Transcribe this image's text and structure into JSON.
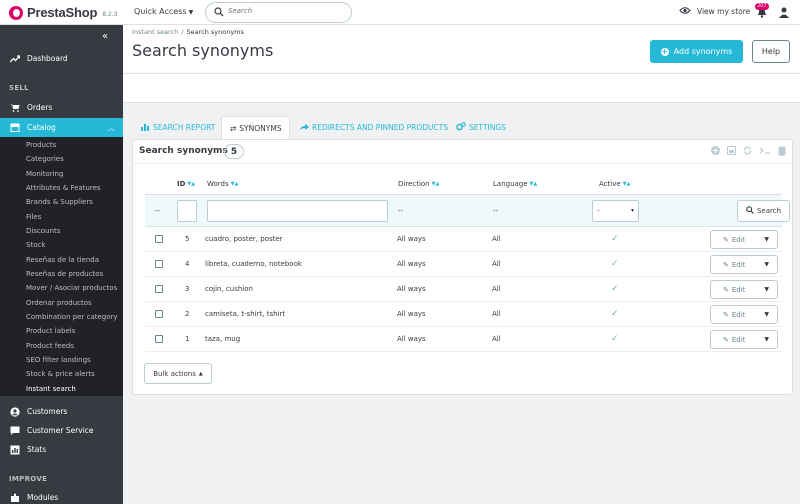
{
  "topbar": {
    "brand": "PrestaShop",
    "version": "8.2.3",
    "quick_access": "Quick Access",
    "search_placeholder": "Search",
    "view_store": "View my store",
    "notification_count": "207"
  },
  "sidebar": {
    "dashboard": "Dashboard",
    "section_sell": "SELL",
    "orders": "Orders",
    "catalog": "Catalog",
    "catalog_sub": [
      "Products",
      "Categories",
      "Monitoring",
      "Attributes & Features",
      "Brands & Suppliers",
      "Files",
      "Discounts",
      "Stock",
      "Reseñas de la tienda",
      "Reseñas de productos",
      "Mover / Asociar productos",
      "Ordenar productos",
      "Combination per category",
      "Product labels",
      "Product feeds",
      "SEO filter landings",
      "Stock & price alerts",
      "Instant search"
    ],
    "customers": "Customers",
    "customer_service": "Customer Service",
    "stats": "Stats",
    "section_improve": "IMPROVE",
    "modules": "Modules"
  },
  "header": {
    "breadcrumb_parent": "Instant search",
    "breadcrumb_current": "Search synonyms",
    "title": "Search synonyms",
    "add_button": "Add synonyms",
    "help_button": "Help"
  },
  "tabs": [
    {
      "label": "SEARCH REPORT",
      "icon": "bar-chart-icon"
    },
    {
      "label": "SYNONYMS",
      "icon": "swap-icon"
    },
    {
      "label": "REDIRECTS AND PINNED PRODUCTS",
      "icon": "share-icon"
    },
    {
      "label": "SETTINGS",
      "icon": "gears-icon"
    }
  ],
  "panel": {
    "title": "Search synonyms",
    "count": "5",
    "columns": [
      "ID",
      "Words",
      "Direction",
      "Language",
      "Active"
    ],
    "filter": {
      "id_dash": "--",
      "direction": "--",
      "language": "--",
      "active_value": "-",
      "search_button": "Search"
    },
    "rows": [
      {
        "id": "5",
        "words": "cuadro, poster, poster",
        "direction": "All ways",
        "language": "All"
      },
      {
        "id": "4",
        "words": "libreta, cuaderno, notebook",
        "direction": "All ways",
        "language": "All"
      },
      {
        "id": "3",
        "words": "cojin, cushion",
        "direction": "All ways",
        "language": "All"
      },
      {
        "id": "2",
        "words": "camiseta, t-shirt, tshirt",
        "direction": "All ways",
        "language": "All"
      },
      {
        "id": "1",
        "words": "taza, mug",
        "direction": "All ways",
        "language": "All"
      }
    ],
    "edit_label": "Edit",
    "bulk_actions": "Bulk actions"
  },
  "colors": {
    "accent": "#25b9d7",
    "sidebar": "#363a41",
    "brand": "#df0067",
    "success": "#70b580"
  }
}
